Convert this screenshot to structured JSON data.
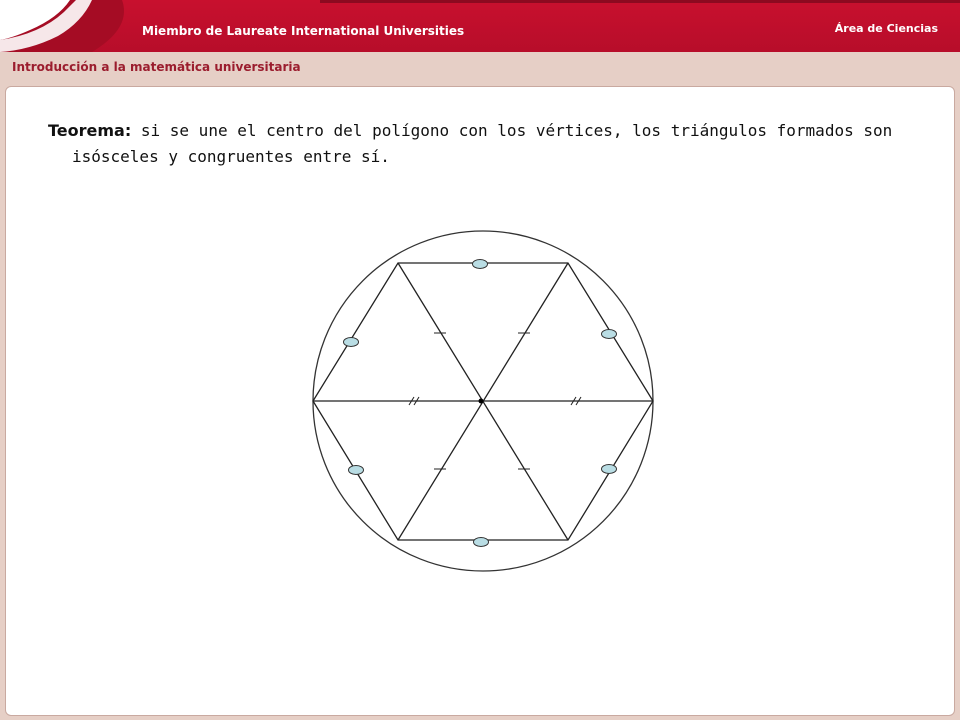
{
  "header": {
    "member_text": "Miembro de Laureate International Universities",
    "area_text": "Área de Ciencias",
    "brand_color": "#c8102e"
  },
  "course_bar": {
    "title": "Introducción a la matemática universitaria"
  },
  "content": {
    "theorem_label": "Teorema:",
    "theorem_text": " si se une el centro del polígono con los vértices, los triángulos formados son isósceles y congruentes entre sí."
  },
  "figure": {
    "shape": "regular hexagon inscribed in circle",
    "vertex_count": 6,
    "center_marked": true,
    "side_markers": "ovals",
    "tick_marks": [
      "single",
      "double"
    ]
  }
}
